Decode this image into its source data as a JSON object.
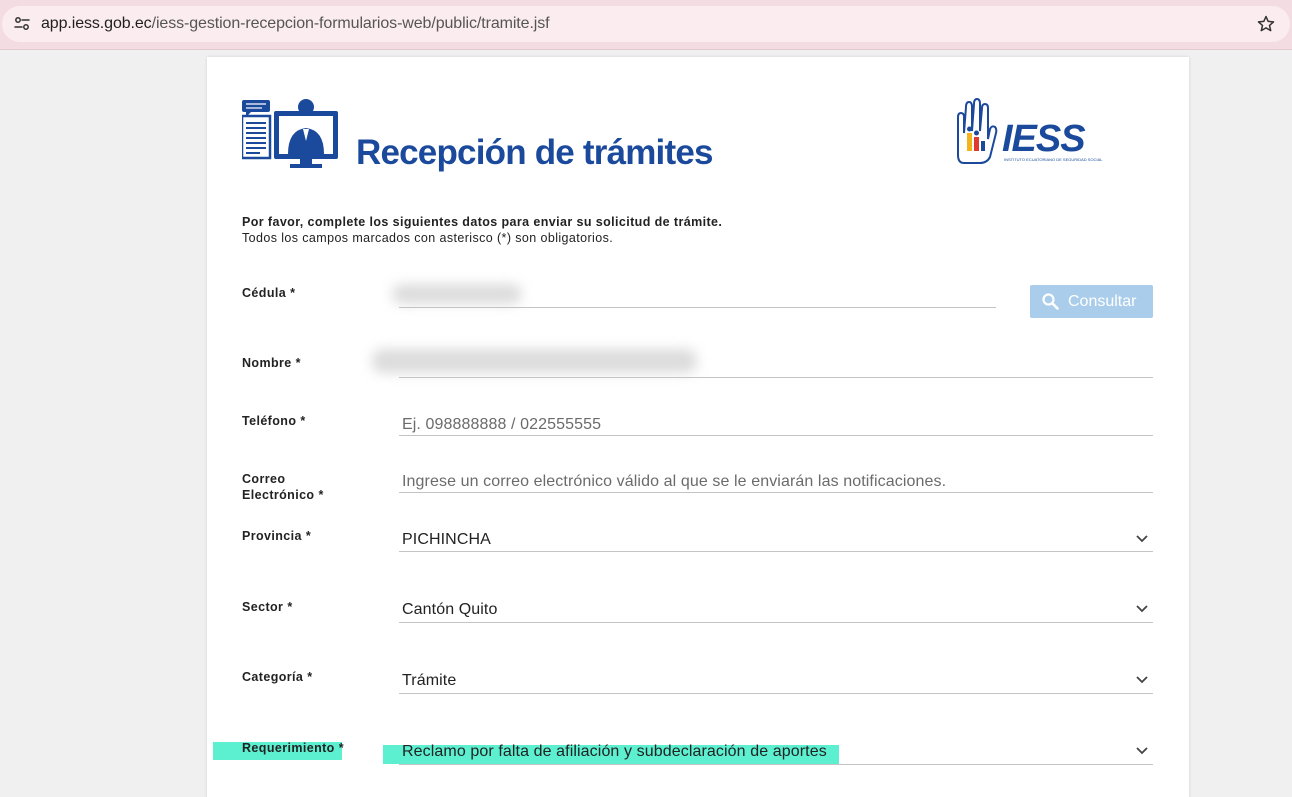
{
  "browser": {
    "url_domain": "app.iess.gob.ec",
    "url_path": "/iess-gestion-recepcion-formularios-web/public/tramite.jsf"
  },
  "header": {
    "title": "Recepción de trámites",
    "logo_text": "IESS",
    "logo_subtext": "INSTITUTO ECUATORIANO DE SEGURIDAD SOCIAL"
  },
  "instructions": {
    "line1": "Por favor, complete los siguientes datos para enviar su solicitud de trámite.",
    "line2": "Todos los campos marcados con asterisco (*) son obligatorios."
  },
  "form": {
    "required_mark": "*",
    "cedula": {
      "label": "Cédula",
      "value": ""
    },
    "consultar_label": "Consultar",
    "nombre": {
      "label": "Nombre",
      "value": ""
    },
    "telefono": {
      "label": "Teléfono",
      "placeholder": "Ej. 098888888 / 022555555"
    },
    "correo": {
      "label_line1": "Correo",
      "label_line2": "Electrónico",
      "placeholder": "Ingrese un correo electrónico válido al que se le enviarán las notificaciones."
    },
    "provincia": {
      "label": "Provincia",
      "value": "PICHINCHA"
    },
    "sector": {
      "label": "Sector",
      "value": "Cantón Quito"
    },
    "categoria": {
      "label": "Categoría",
      "value": "Trámite"
    },
    "requerimiento": {
      "label": "Requerimiento",
      "value": "Reclamo por falta de afiliación y subdeclaración de aportes"
    }
  },
  "colors": {
    "title_blue": "#1b4a9c",
    "button_disabled": "#a9cdea",
    "highlight": "#5cf0d1",
    "browser_bar": "#f3dde2"
  },
  "icons": {
    "site_info": "site-info-icon",
    "bookmark": "star-icon",
    "search": "search-icon",
    "dropdown": "chevron-down-icon"
  }
}
